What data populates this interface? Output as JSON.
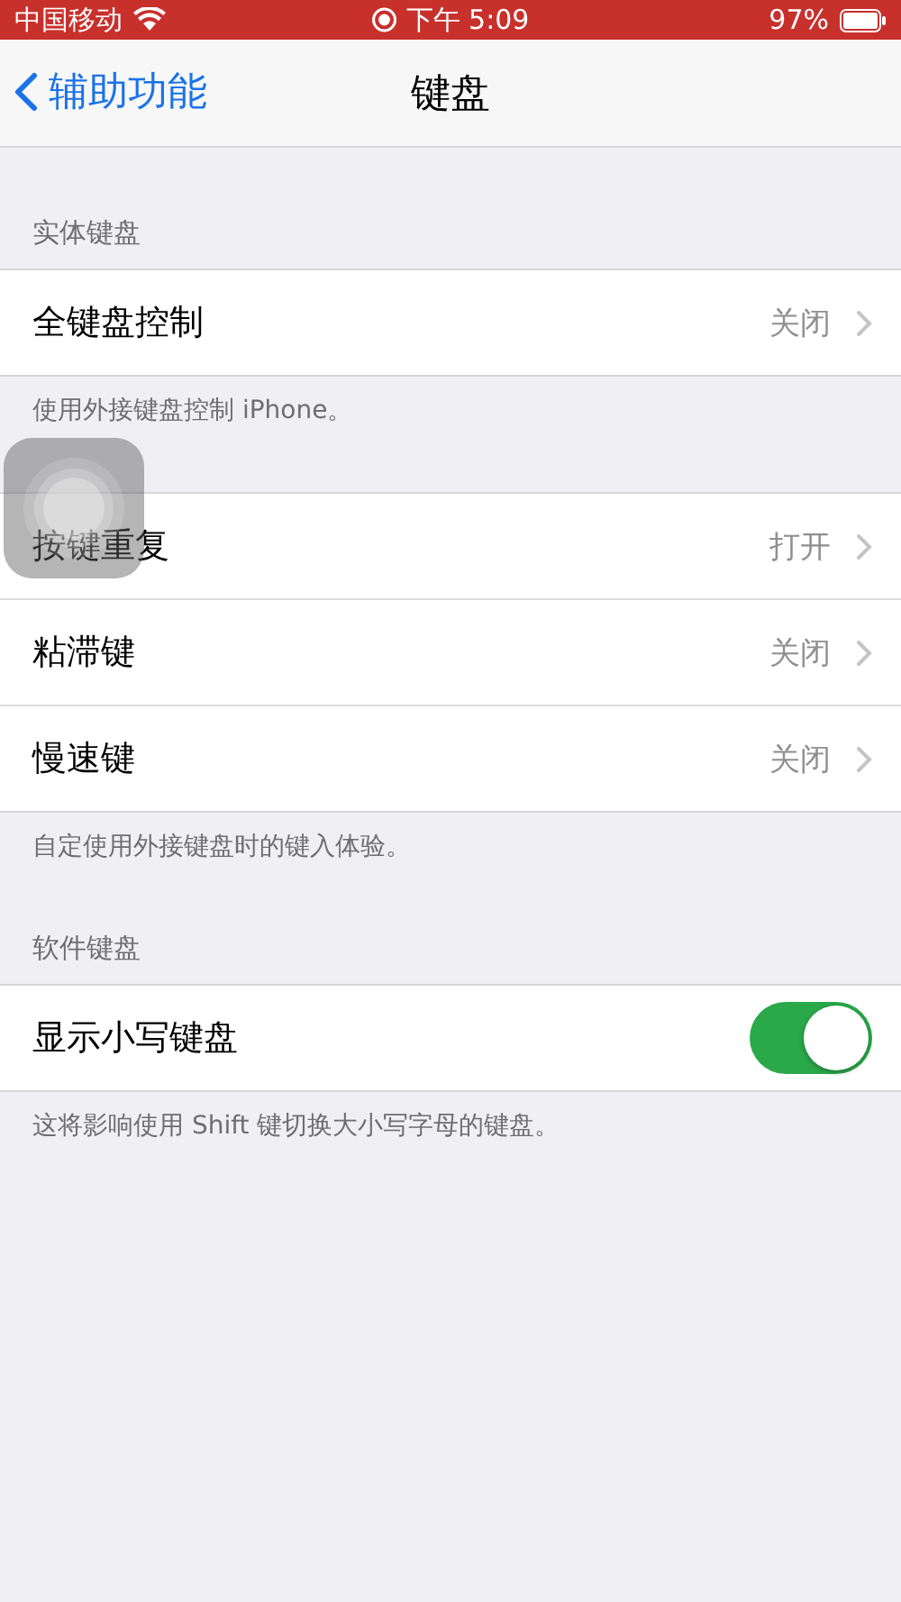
{
  "status_bar": {
    "carrier": "中国移动",
    "time": "下午 5:09",
    "battery": "97%"
  },
  "nav": {
    "back": "辅助功能",
    "title": "键盘"
  },
  "sections": [
    {
      "header": "实体键盘",
      "rows": [
        {
          "kind": "link",
          "label": "全键盘控制",
          "value": "关闭"
        }
      ],
      "footer": "使用外接键盘控制 iPhone。"
    },
    {
      "rows": [
        {
          "kind": "link",
          "label": "按键重复",
          "value": "打开"
        },
        {
          "kind": "link",
          "label": "粘滞键",
          "value": "关闭"
        },
        {
          "kind": "link",
          "label": "慢速键",
          "value": "关闭"
        }
      ],
      "footer": "自定使用外接键盘时的键入体验。"
    },
    {
      "header": "软件键盘",
      "rows": [
        {
          "kind": "toggle",
          "label": "显示小写键盘",
          "on": true
        }
      ],
      "footer": "这将影响使用 Shift 键切换大小写字母的键盘。"
    }
  ]
}
